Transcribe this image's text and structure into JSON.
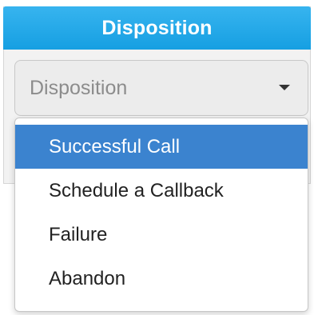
{
  "panel": {
    "title": "Disposition",
    "header_color": "#1aa3e6"
  },
  "select": {
    "placeholder": "Disposition",
    "icon": "caret-down-icon"
  },
  "menu": {
    "items": [
      {
        "label": "Successful Call",
        "active": true
      },
      {
        "label": "Schedule a Callback",
        "active": false
      },
      {
        "label": "Failure",
        "active": false
      },
      {
        "label": "Abandon",
        "active": false
      }
    ],
    "active_color": "#3b83cf"
  }
}
